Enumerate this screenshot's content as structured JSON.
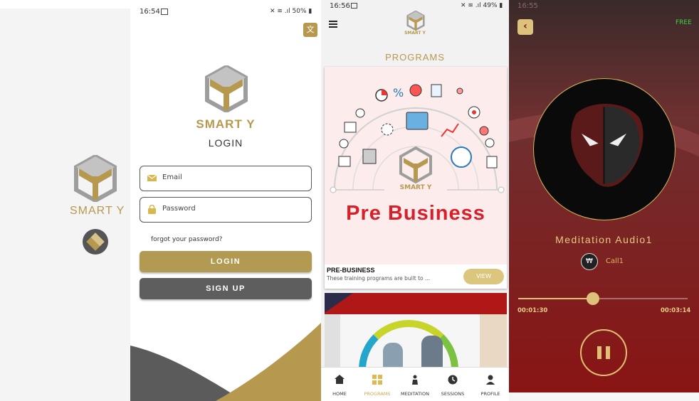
{
  "colors": {
    "gold": "#b6994f",
    "dark_gray": "#5c5c5c",
    "burgundy": "#7a1212",
    "free_green": "#3fd23f"
  },
  "splash": {
    "brand": "SMART Y"
  },
  "login": {
    "status_time": "16:54",
    "status_battery": "50%",
    "brand": "SMART Y",
    "title": "LOGIN",
    "email_placeholder": "Email",
    "password_placeholder": "Password",
    "forgot": "forgot your password?",
    "login_label": "LOGIN",
    "signup_label": "SIGN UP",
    "translate_icon": "translate-icon"
  },
  "programs": {
    "status_time": "16:56",
    "status_battery": "49%",
    "logo_text": "SMART Y",
    "section_title": "PROGRAMS",
    "card1": {
      "banner_brand": "SMART Y",
      "banner_title": "Pre Business",
      "title": "PRE-BUSINESS",
      "desc": "These training programs are built to ...",
      "view_label": "VIEW"
    },
    "nav": [
      {
        "label": "HOME",
        "icon": "home-icon"
      },
      {
        "label": "PROGRAMS",
        "icon": "grid-icon",
        "active": true
      },
      {
        "label": "MEDITATION",
        "icon": "meditation-icon"
      },
      {
        "label": "SESSIONS",
        "icon": "clock-icon"
      },
      {
        "label": "PROFILE",
        "icon": "profile-icon"
      }
    ]
  },
  "player": {
    "status_time": "16:55",
    "free_label": "FREE",
    "track_title": "Meditation Audio1",
    "artist": "Call1",
    "elapsed": "00:01:30",
    "total": "00:03:14",
    "progress": 0.44
  }
}
